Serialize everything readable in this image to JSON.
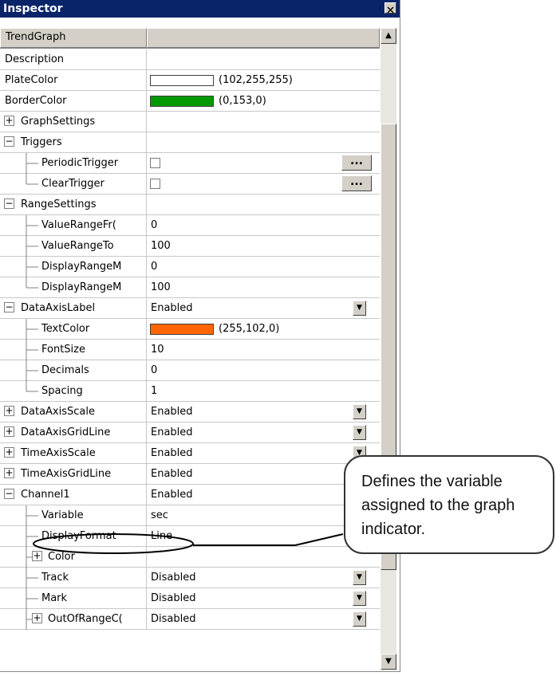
{
  "window": {
    "title": "Inspector",
    "close_glyph": "×",
    "header_name": "TrendGraph"
  },
  "rows": [
    {
      "name": "Description",
      "value": "",
      "type": "text",
      "indent": 0
    },
    {
      "name": "PlateColor",
      "value": "(102,255,255)",
      "type": "color",
      "swatch": "#ffffff",
      "indent": 0
    },
    {
      "name": "BorderColor",
      "value": "(0,153,0)",
      "type": "color",
      "swatch": "#009900",
      "indent": 0
    },
    {
      "name": "GraphSettings",
      "value": "",
      "type": "text",
      "indent": 0,
      "expander": "+"
    },
    {
      "name": "Triggers",
      "value": "",
      "type": "text",
      "indent": 0,
      "expander": "−"
    },
    {
      "name": "PeriodicTrigger",
      "value": "",
      "type": "checkbox",
      "indent": 1,
      "dots": "..."
    },
    {
      "name": "ClearTrigger",
      "value": "",
      "type": "checkbox",
      "indent": 1,
      "dots": "...",
      "last": true
    },
    {
      "name": "RangeSettings",
      "value": "",
      "type": "text",
      "indent": 0,
      "expander": "−"
    },
    {
      "name": "ValueRangeFr(",
      "value": "0",
      "type": "text",
      "indent": 1
    },
    {
      "name": "ValueRangeTo",
      "value": "100",
      "type": "text",
      "indent": 1
    },
    {
      "name": "DisplayRangeM",
      "value": "0",
      "type": "text",
      "indent": 1
    },
    {
      "name": "DisplayRangeM",
      "value": "100",
      "type": "text",
      "indent": 1,
      "last": true
    },
    {
      "name": "DataAxisLabel",
      "value": "Enabled",
      "type": "dropdown",
      "indent": 0,
      "expander": "−"
    },
    {
      "name": "TextColor",
      "value": "(255,102,0)",
      "type": "color",
      "swatch": "#ff6600",
      "indent": 1
    },
    {
      "name": "FontSize",
      "value": "10",
      "type": "text",
      "indent": 1
    },
    {
      "name": "Decimals",
      "value": "0",
      "type": "text",
      "indent": 1
    },
    {
      "name": "Spacing",
      "value": "1",
      "type": "text",
      "indent": 1,
      "last": true
    },
    {
      "name": "DataAxisScale",
      "value": "Enabled",
      "type": "dropdown",
      "indent": 0,
      "expander": "+"
    },
    {
      "name": "DataAxisGridLine",
      "value": "Enabled",
      "type": "dropdown",
      "indent": 0,
      "expander": "+"
    },
    {
      "name": "TimeAxisScale",
      "value": "Enabled",
      "type": "dropdown",
      "indent": 0,
      "expander": "+"
    },
    {
      "name": "TimeAxisGridLine",
      "value": "Enabled",
      "type": "dropdown",
      "indent": 0,
      "expander": "+"
    },
    {
      "name": "Channel1",
      "value": "Enabled",
      "type": "text",
      "indent": 0,
      "expander": "−"
    },
    {
      "name": "Variable",
      "value": "sec",
      "type": "text",
      "indent": 1
    },
    {
      "name": "DisplayFormat",
      "value": "Line",
      "type": "text",
      "indent": 1
    },
    {
      "name": "Color",
      "value": "",
      "type": "text",
      "indent": 1,
      "expander": "+"
    },
    {
      "name": "Track",
      "value": "Disabled",
      "type": "dropdown",
      "indent": 1
    },
    {
      "name": "Mark",
      "value": "Disabled",
      "type": "dropdown",
      "indent": 1
    },
    {
      "name": "OutOfRangeC(",
      "value": "Disabled",
      "type": "dropdown",
      "indent": 1,
      "expander": "+"
    }
  ],
  "colors": {
    "title_bar": "#0a246a",
    "panel": "#d4d0c8"
  },
  "callout": {
    "text": "Defines the variable assigned to the graph indicator."
  }
}
